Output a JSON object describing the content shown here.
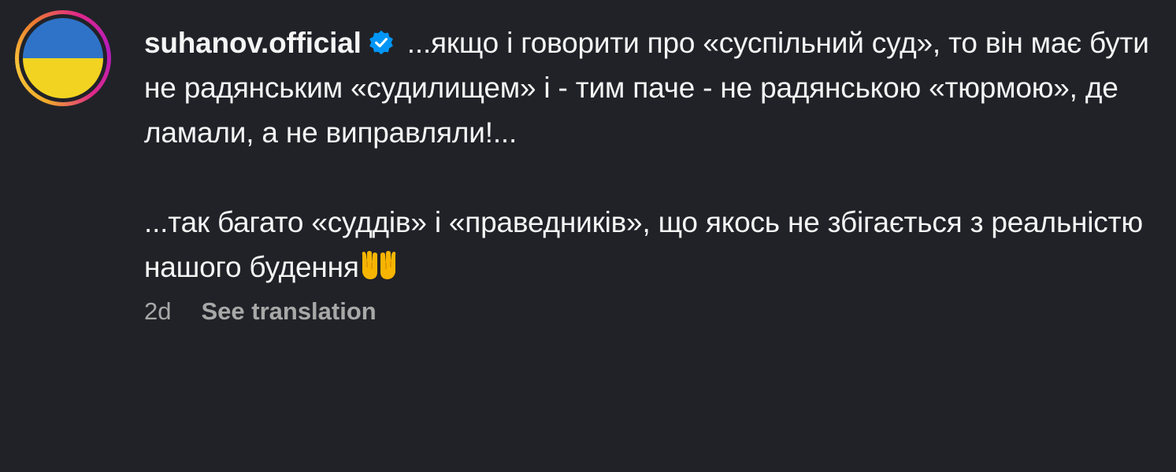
{
  "comment": {
    "username": "suhanov.official",
    "verified": true,
    "paragraph_1": " ...якщо і говорити про «суспільний суд», то він має бути не радянським «судилищем» і - тим паче - не радянською «тюрмою», де ламали, а не виправляли!...",
    "paragraph_2": "...так багато «суддів» і «праведників», що якось не збігається з реальністю нашого будення",
    "emoji": "palms-up-together",
    "time_ago": "2d",
    "see_translation_label": "See translation"
  },
  "colors": {
    "background": "#212228",
    "text": "#f5f5f5",
    "muted": "#a8a8a8",
    "verified_badge": "#0095f6",
    "flag_blue": "#2f73c8",
    "flag_yellow": "#f2d321"
  },
  "icons": {
    "verified": "verified-badge-icon",
    "avatar": "ukraine-flag-avatar"
  }
}
